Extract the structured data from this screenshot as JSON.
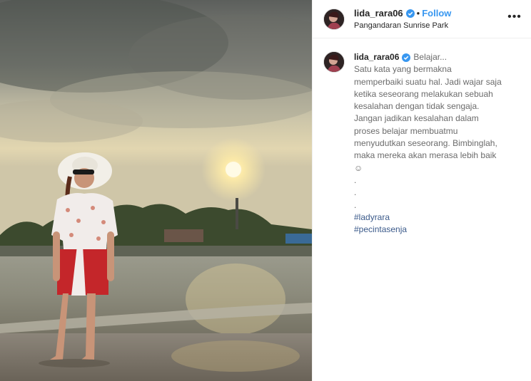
{
  "post": {
    "username": "lida_rara06",
    "follow_label": "Follow",
    "separator": "•",
    "location": "Pangandaran Sunrise Park",
    "more_label": "•••"
  },
  "comment": {
    "username": "lida_rara06",
    "first_word": "Belajar...",
    "caption_lines": [
      "Satu kata yang bermakna",
      "memperbaiki suatu hal. Jadi wajar saja",
      "ketika seseorang melakukan sebuah",
      "kesalahan dengan tidak sengaja.",
      "Jangan jadikan kesalahan dalam",
      "proses belajar membuatmu",
      "menyudutkan seseorang. Bimbinglah,",
      "maka mereka akan merasa lebih baik",
      "☺",
      ".",
      ".",
      "."
    ],
    "hashtags": [
      "#ladyrara",
      "#pecintasenja"
    ]
  },
  "colors": {
    "link_blue": "#3897f0",
    "hashtag": "#3b5a8a",
    "verified": "#3897f0"
  }
}
